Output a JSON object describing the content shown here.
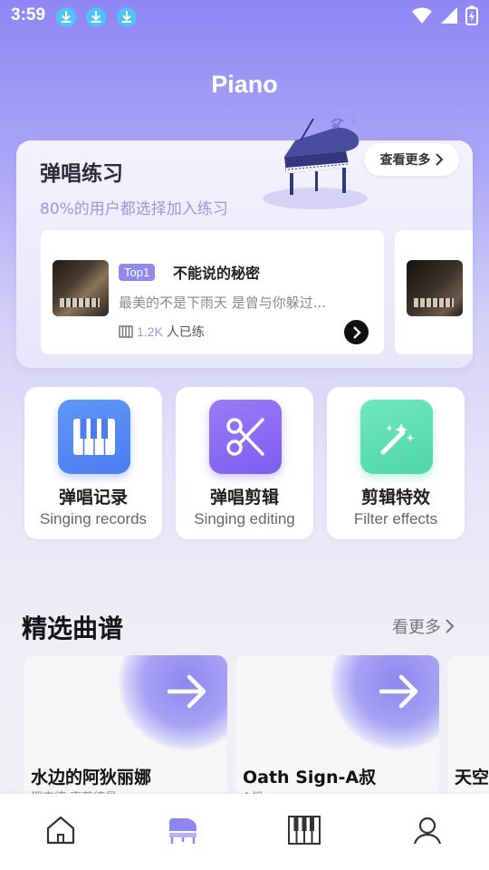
{
  "status_bar": {
    "time": "3:59",
    "download_icons": [
      "download-icon",
      "download-icon",
      "download-icon"
    ],
    "wifi": "wifi-icon",
    "signal": "signal-icon",
    "battery": "battery-charging-icon"
  },
  "header": {
    "title": "Piano"
  },
  "practice": {
    "title": "弹唱练习",
    "subtitle": "80%的用户都选择加入练习",
    "see_more": "查看更多",
    "songs": [
      {
        "badge": "Top1",
        "name": "不能说的秘密",
        "lyric": "最美的不是下雨天 是曾与你躲过...",
        "count": "1.2K",
        "count_suffix": "人已练"
      }
    ]
  },
  "features": [
    {
      "title": "弹唱记录",
      "subtitle": "Singing records",
      "icon": "piano-keys-icon",
      "color": "#5b8ef6"
    },
    {
      "title": "弹唱剪辑",
      "subtitle": "Singing editing",
      "icon": "scissors-icon",
      "color": "#8b6ef3"
    },
    {
      "title": "剪辑特效",
      "subtitle": "Filter effects",
      "icon": "magic-wand-icon",
      "color": "#5fe0b4"
    }
  ],
  "featured": {
    "title": "精选曲谱",
    "more": "看更多",
    "cards": [
      {
        "name": "水边的阿狄丽娜",
        "author": "理查德·克莱德曼"
      },
      {
        "name": "Oath Sign-A叔",
        "author": "A叔"
      },
      {
        "name": "天空",
        "author": ""
      }
    ]
  },
  "nav": {
    "items": [
      {
        "icon": "home-icon",
        "active": false
      },
      {
        "icon": "grand-piano-icon",
        "active": true
      },
      {
        "icon": "piano-keys-icon",
        "active": false
      },
      {
        "icon": "profile-icon",
        "active": false
      }
    ],
    "active_color": "#8d86f0"
  }
}
